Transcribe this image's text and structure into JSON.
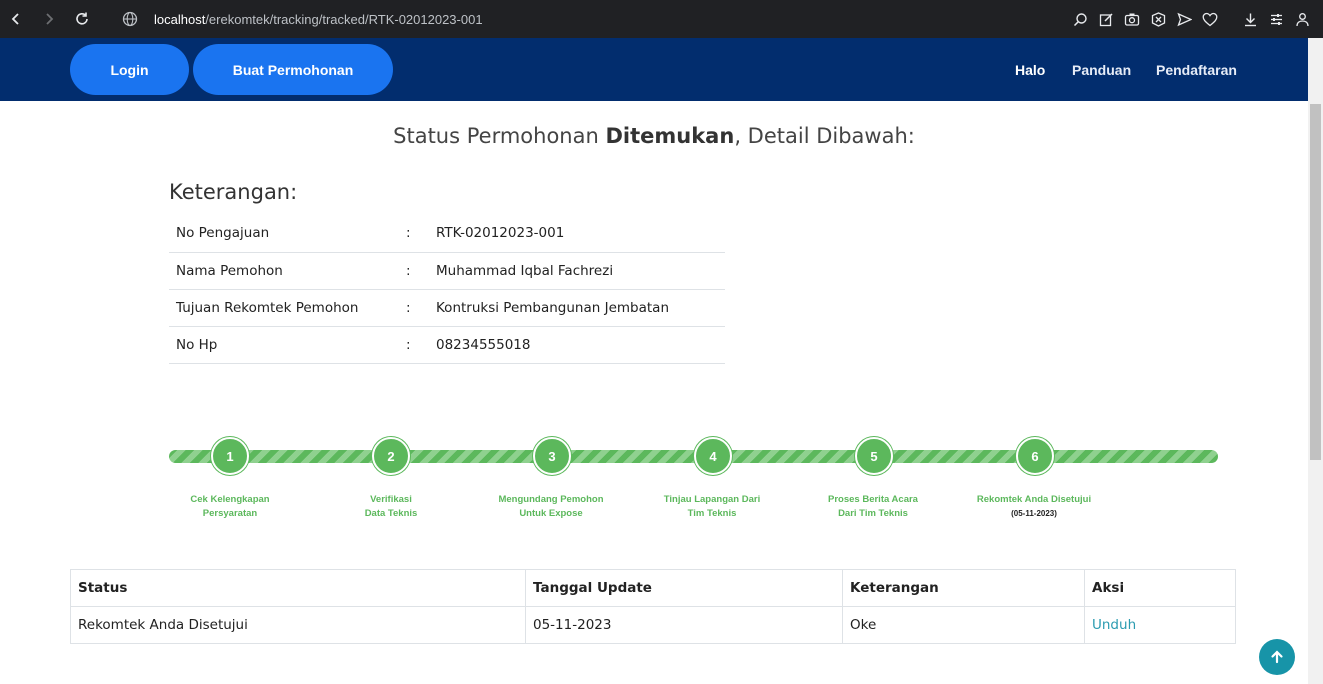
{
  "browser": {
    "url_host": "localhost",
    "url_path": "/erekomtek/tracking/tracked/RTK-02012023-001"
  },
  "navbar": {
    "login_label": "Login",
    "buat_label": "Buat Permohonan",
    "links": [
      "Halo",
      "Panduan",
      "Pendaftaran"
    ]
  },
  "heading": {
    "prefix": "Status Permohonan ",
    "bold": "Ditemukan",
    "suffix": ", Detail Dibawah:"
  },
  "keterangan": {
    "title": "Keterangan:",
    "separator": ":",
    "rows": [
      {
        "label": "No Pengajuan",
        "value": "RTK-02012023-001"
      },
      {
        "label": "Nama Pemohon",
        "value": "Muhammad Iqbal Fachrezi"
      },
      {
        "label": "Tujuan Rekomtek Pemohon",
        "value": "Kontruksi Pembangunan Jembatan"
      },
      {
        "label": "No Hp",
        "value": "08234555018"
      }
    ]
  },
  "progress": {
    "color": "#5cb85c",
    "steps": [
      {
        "number": "1",
        "line1": "Cek Kelengkapan",
        "line2": "Persyaratan",
        "date": ""
      },
      {
        "number": "2",
        "line1": "Verifikasi",
        "line2": "Data Teknis",
        "date": ""
      },
      {
        "number": "3",
        "line1": "Mengundang Pemohon",
        "line2": "Untuk Expose",
        "date": ""
      },
      {
        "number": "4",
        "line1": "Tinjau Lapangan Dari",
        "line2": "Tim Teknis",
        "date": ""
      },
      {
        "number": "5",
        "line1": "Proses Berita Acara",
        "line2": "Dari Tim Teknis",
        "date": ""
      },
      {
        "number": "6",
        "line1": "Rekomtek Anda Disetujui",
        "line2": "",
        "date": "(05-11-2023)"
      }
    ]
  },
  "status_table": {
    "headers": [
      "Status",
      "Tanggal Update",
      "Keterangan",
      "Aksi"
    ],
    "rows": [
      {
        "status": "Rekomtek Anda Disetujui",
        "tanggal": "05-11-2023",
        "keterangan": "Oke",
        "aksi": "Unduh"
      }
    ]
  },
  "icons": {
    "back_top": "arrow-up-icon"
  }
}
